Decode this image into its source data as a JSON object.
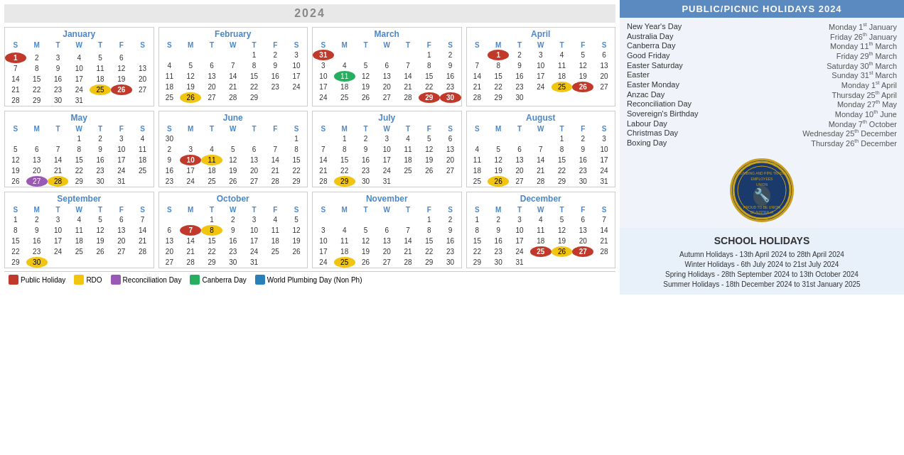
{
  "year": "2024",
  "holidays_header": "PUBLIC/PICNIC HOLIDAYS 2024",
  "public_holidays": [
    {
      "name": "New Year's Day",
      "date": "Monday 1",
      "sup": "st",
      "rest": " January"
    },
    {
      "name": "Australia Day",
      "date": "Friday 26",
      "sup": "th",
      "rest": " January"
    },
    {
      "name": "Canberra Day",
      "date": "Monday 11",
      "sup": "th",
      "rest": " March"
    },
    {
      "name": "Good Friday",
      "date": "Friday 29",
      "sup": "th",
      "rest": " March"
    },
    {
      "name": "Easter Saturday",
      "date": "Saturday 30",
      "sup": "th",
      "rest": " March"
    },
    {
      "name": "Easter",
      "date": "Sunday 31",
      "sup": "st",
      "rest": " March"
    },
    {
      "name": "Easter Monday",
      "date": "Monday 1",
      "sup": "st",
      "rest": " April"
    },
    {
      "name": "Anzac Day",
      "date": "Thursday 25",
      "sup": "th",
      "rest": " April"
    },
    {
      "name": "Reconciliation Day",
      "date": "Monday 27",
      "sup": "th",
      "rest": " May"
    },
    {
      "name": "Sovereign's Birthday",
      "date": "Monday 10",
      "sup": "th",
      "rest": " June"
    },
    {
      "name": "Labour Day",
      "date": "Monday 7",
      "sup": "th",
      "rest": " October"
    },
    {
      "name": "Christmas Day",
      "date": "Wednesday 25",
      "sup": "th",
      "rest": " December"
    },
    {
      "name": "Boxing Day",
      "date": "Thursday 26",
      "sup": "th",
      "rest": " December"
    }
  ],
  "school_holidays_header": "SCHOOL HOLIDAYS",
  "school_holidays": [
    "Autumn Holidays - 13th April 2024 to 28th April 2024",
    "Winter Holidays - 6th July 2024 to 21st July 2024",
    "Spring Holidays - 28th September 2024 to 13th October 2024",
    "Summer Holidays - 18th December 2024 to 31st January 2025"
  ],
  "legend": [
    {
      "label": "Public Holiday",
      "color": "#c0392b"
    },
    {
      "label": "RDO",
      "color": "#f1c40f"
    },
    {
      "label": "Reconciliation Day",
      "color": "#9b59b6"
    },
    {
      "label": "Canberra Day",
      "color": "#27ae60"
    },
    {
      "label": "World Plumbing Day (Non Ph)",
      "color": "#2980b9"
    }
  ],
  "months": [
    {
      "name": "January",
      "weeks": [
        [
          "",
          "",
          "",
          "",
          "",
          "",
          ""
        ],
        [
          "ph:1",
          "2",
          "3",
          "4",
          "5",
          "6",
          ""
        ],
        [
          "7",
          "8",
          "9",
          "10",
          "11",
          "12",
          "13"
        ],
        [
          "14",
          "15",
          "16",
          "17",
          "18",
          "19",
          "20"
        ],
        [
          "21",
          "22",
          "23",
          "24",
          "rdo:25",
          "ph:26",
          "27"
        ],
        [
          "28",
          "29",
          "30",
          "31",
          "",
          "",
          ""
        ]
      ]
    },
    {
      "name": "February",
      "weeks": [
        [
          "",
          "",
          "",
          "",
          "1",
          "2",
          "3"
        ],
        [
          "4",
          "5",
          "6",
          "7",
          "8",
          "9",
          "10"
        ],
        [
          "11",
          "12",
          "13",
          "14",
          "15",
          "16",
          "17"
        ],
        [
          "18",
          "19",
          "20",
          "21",
          "22",
          "23",
          "24"
        ],
        [
          "25",
          "rdo:26",
          "27",
          "28",
          "29",
          "",
          ""
        ]
      ]
    },
    {
      "name": "March",
      "weeks": [
        [
          "ph:31",
          "",
          "",
          "",
          "",
          "1",
          "2"
        ],
        [
          "3",
          "4",
          "5",
          "6",
          "7",
          "8",
          "9"
        ],
        [
          "10",
          "canberra:11",
          "12",
          "13",
          "14",
          "15",
          "16"
        ],
        [
          "17",
          "18",
          "19",
          "20",
          "21",
          "22",
          "23"
        ],
        [
          "24",
          "25",
          "26",
          "27",
          "28",
          "ph:29",
          "ph:30"
        ]
      ]
    },
    {
      "name": "April",
      "weeks": [
        [
          "",
          "ph:1",
          "2",
          "3",
          "4",
          "5",
          "6"
        ],
        [
          "7",
          "8",
          "9",
          "10",
          "11",
          "12",
          "13"
        ],
        [
          "14",
          "15",
          "16",
          "17",
          "18",
          "19",
          "20"
        ],
        [
          "21",
          "22",
          "23",
          "24",
          "rdo:25",
          "ph:26",
          "27"
        ],
        [
          "28",
          "29",
          "30",
          "",
          "",
          "",
          ""
        ]
      ]
    },
    {
      "name": "May",
      "weeks": [
        [
          "",
          "",
          "",
          "1",
          "2",
          "3",
          "4"
        ],
        [
          "5",
          "6",
          "7",
          "8",
          "9",
          "10",
          "11"
        ],
        [
          "12",
          "13",
          "14",
          "15",
          "16",
          "17",
          "18"
        ],
        [
          "19",
          "20",
          "21",
          "22",
          "23",
          "24",
          "25"
        ],
        [
          "26",
          "reconciliation:27",
          "rdo:28",
          "29",
          "30",
          "31",
          ""
        ]
      ]
    },
    {
      "name": "June",
      "weeks": [
        [
          "30",
          "",
          "",
          "",
          "",
          "",
          "1"
        ],
        [
          "2",
          "3",
          "4",
          "5",
          "6",
          "7",
          "8"
        ],
        [
          "9",
          "ph:10",
          "rdo:11",
          "12",
          "13",
          "14",
          "15"
        ],
        [
          "16",
          "17",
          "18",
          "19",
          "20",
          "21",
          "22"
        ],
        [
          "23",
          "24",
          "25",
          "26",
          "27",
          "28",
          "29"
        ]
      ]
    },
    {
      "name": "July",
      "weeks": [
        [
          "",
          "1",
          "2",
          "3",
          "4",
          "5",
          "6"
        ],
        [
          "7",
          "8",
          "9",
          "10",
          "11",
          "12",
          "13"
        ],
        [
          "14",
          "15",
          "16",
          "17",
          "18",
          "19",
          "20"
        ],
        [
          "21",
          "22",
          "23",
          "24",
          "25",
          "26",
          "27"
        ],
        [
          "28",
          "rdo:29",
          "30",
          "31",
          "",
          "",
          ""
        ]
      ]
    },
    {
      "name": "August",
      "weeks": [
        [
          "",
          "",
          "",
          "",
          "1",
          "2",
          "3"
        ],
        [
          "4",
          "5",
          "6",
          "7",
          "8",
          "9",
          "10"
        ],
        [
          "11",
          "12",
          "13",
          "14",
          "15",
          "16",
          "17"
        ],
        [
          "18",
          "19",
          "20",
          "21",
          "22",
          "23",
          "24"
        ],
        [
          "25",
          "rdo:26",
          "27",
          "28",
          "29",
          "30",
          "31"
        ]
      ]
    },
    {
      "name": "September",
      "weeks": [
        [
          "1",
          "2",
          "3",
          "4",
          "5",
          "6",
          "7"
        ],
        [
          "8",
          "9",
          "10",
          "11",
          "12",
          "13",
          "14"
        ],
        [
          "15",
          "16",
          "17",
          "18",
          "19",
          "20",
          "21"
        ],
        [
          "22",
          "23",
          "24",
          "25",
          "26",
          "27",
          "28"
        ],
        [
          "29",
          "rdo:30",
          "",
          "",
          "",
          "",
          ""
        ]
      ]
    },
    {
      "name": "October",
      "weeks": [
        [
          "",
          "",
          "1",
          "2",
          "3",
          "4",
          "5"
        ],
        [
          "6",
          "ph:7",
          "rdo:8",
          "9",
          "10",
          "11",
          "12"
        ],
        [
          "13",
          "14",
          "15",
          "16",
          "17",
          "18",
          "19"
        ],
        [
          "20",
          "21",
          "22",
          "23",
          "24",
          "25",
          "26"
        ],
        [
          "27",
          "28",
          "29",
          "30",
          "31",
          "",
          ""
        ]
      ]
    },
    {
      "name": "November",
      "weeks": [
        [
          "",
          "",
          "",
          "",
          "",
          "1",
          "2"
        ],
        [
          "3",
          "4",
          "5",
          "6",
          "7",
          "8",
          "9"
        ],
        [
          "10",
          "11",
          "12",
          "13",
          "14",
          "15",
          "16"
        ],
        [
          "17",
          "18",
          "19",
          "20",
          "21",
          "22",
          "23"
        ],
        [
          "24",
          "rdo:25",
          "26",
          "27",
          "28",
          "29",
          "30"
        ]
      ]
    },
    {
      "name": "December",
      "weeks": [
        [
          "1",
          "2",
          "3",
          "4",
          "5",
          "6",
          "7"
        ],
        [
          "8",
          "9",
          "10",
          "11",
          "12",
          "13",
          "14"
        ],
        [
          "15",
          "16",
          "17",
          "18",
          "19",
          "20",
          "21"
        ],
        [
          "22",
          "23",
          "24",
          "ph:25",
          "rdo:26",
          "ph:27",
          "28"
        ],
        [
          "29",
          "30",
          "31",
          "",
          "",
          "",
          ""
        ]
      ]
    }
  ]
}
